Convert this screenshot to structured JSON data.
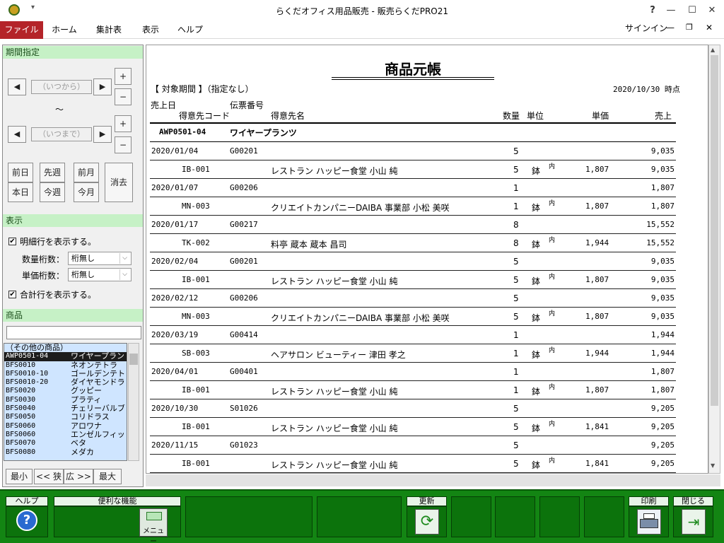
{
  "window": {
    "title": "らくだオフィス用品販売 - 販売らくだPRO21",
    "help": "?",
    "signin": "サインイン"
  },
  "ribbon": {
    "tabs": [
      "ファイル",
      "ホーム",
      "集計表",
      "表示",
      "ヘルプ"
    ]
  },
  "period": {
    "header": "期間指定",
    "from_placeholder": "（いつから）",
    "to_placeholder": "（いつまで）",
    "tilde": "～",
    "plus": "+",
    "minus": "−",
    "left_arrow": "◀",
    "right_arrow": "▶",
    "btn_prev_day": "前日",
    "btn_prev_week": "先週",
    "btn_prev_month": "前月",
    "btn_today": "本日",
    "btn_this_week": "今週",
    "btn_this_month": "今月",
    "btn_clear": "消去"
  },
  "display": {
    "header": "表示",
    "show_detail": "明細行を表示する。",
    "qty_digits_label": "数量桁数：",
    "qty_digits_value": "桁無し",
    "price_digits_label": "単価桁数：",
    "price_digits_value": "桁無し",
    "show_total": "合計行を表示する。",
    "checked": "✔"
  },
  "product": {
    "header": "商品",
    "search_value": "",
    "items": [
      {
        "code": "（その他の商品）",
        "name": ""
      },
      {
        "code": "AWP0501-04",
        "name": "ワイヤープラン"
      },
      {
        "code": "BFS0010",
        "name": "ネオンテトラ"
      },
      {
        "code": "BFS0010-10",
        "name": "ゴールデンテト"
      },
      {
        "code": "BFS0010-20",
        "name": "ダイヤモンドラ"
      },
      {
        "code": "BFS0020",
        "name": "グッピー"
      },
      {
        "code": "BFS0030",
        "name": "プラティ"
      },
      {
        "code": "BFS0040",
        "name": "チェリーバルブ"
      },
      {
        "code": "BFS0050",
        "name": "コリドラス"
      },
      {
        "code": "BFS0060",
        "name": "アロワナ"
      },
      {
        "code": "BFS0060",
        "name": "エンゼルフィッ"
      },
      {
        "code": "BFS0070",
        "name": "ベタ"
      },
      {
        "code": "BFS0080",
        "name": "メダカ"
      }
    ],
    "btn_min": "最小",
    "btn_narrow": "<< 狭",
    "btn_wide": "広 >>",
    "btn_max": "最大"
  },
  "report": {
    "title": "商品元帳",
    "period_label": "【 対象期間 】（指定なし）",
    "as_of": "2020/10/30 時点",
    "col_sale_date": "売上日",
    "col_slip_no": "伝票番号",
    "col_cust_code": "得意先コード",
    "col_cust_name": "得意先名",
    "col_qty": "数量",
    "col_unit": "単位",
    "col_price": "単価",
    "col_amount": "売上",
    "product_code": "AWP0501-04",
    "product_name": "ワイヤープランツ",
    "rows": [
      {
        "date": "2020/01/04",
        "slip": "G00201",
        "qty": "5",
        "amount": "9,035",
        "code": "IB-001",
        "name": "レストラン ハッピー食堂 小山 純",
        "unit": "鉢",
        "tax": "内",
        "price": "1,807"
      },
      {
        "date": "2020/01/07",
        "slip": "G00206",
        "qty": "1",
        "amount": "1,807",
        "code": "MN-003",
        "name": "クリエイトカンパニーDAIBA 事業部 小松 美咲",
        "unit": "鉢",
        "tax": "内",
        "price": "1,807"
      },
      {
        "date": "2020/01/17",
        "slip": "G00217",
        "qty": "8",
        "amount": "15,552",
        "code": "TK-002",
        "name": "料亭 蔵本 蔵本 昌司",
        "unit": "鉢",
        "tax": "内",
        "price": "1,944"
      },
      {
        "date": "2020/02/04",
        "slip": "G00201",
        "qty": "5",
        "amount": "9,035",
        "code": "IB-001",
        "name": "レストラン ハッピー食堂 小山 純",
        "unit": "鉢",
        "tax": "内",
        "price": "1,807"
      },
      {
        "date": "2020/02/12",
        "slip": "G00206",
        "qty": "5",
        "amount": "9,035",
        "code": "MN-003",
        "name": "クリエイトカンパニーDAIBA 事業部 小松 美咲",
        "unit": "鉢",
        "tax": "内",
        "price": "1,807"
      },
      {
        "date": "2020/03/19",
        "slip": "G00414",
        "qty": "1",
        "amount": "1,944",
        "code": "SB-003",
        "name": "ヘアサロン ビューティー 津田 孝之",
        "unit": "鉢",
        "tax": "内",
        "price": "1,944"
      },
      {
        "date": "2020/04/01",
        "slip": "G00401",
        "qty": "1",
        "amount": "1,807",
        "code": "IB-001",
        "name": "レストラン ハッピー食堂 小山 純",
        "unit": "鉢",
        "tax": "内",
        "price": "1,807"
      },
      {
        "date": "2020/10/30",
        "slip": "S01026",
        "qty": "5",
        "amount": "9,205",
        "code": "IB-001",
        "name": "レストラン ハッピー食堂 小山 純",
        "unit": "鉢",
        "tax": "内",
        "price": "1,841"
      },
      {
        "date": "2020/11/15",
        "slip": "G01023",
        "qty": "5",
        "amount": "9,205",
        "code": "IB-001",
        "name": "レストラン ハッピー食堂 小山 純",
        "unit": "鉢",
        "tax": "内",
        "price": "1,841"
      }
    ]
  },
  "bottom": {
    "help": "ヘルプ",
    "tools": "便利な機能",
    "menu": "メニュー",
    "refresh": "更新",
    "print": "印刷",
    "close": "閉じる",
    "help_icon": "?"
  }
}
